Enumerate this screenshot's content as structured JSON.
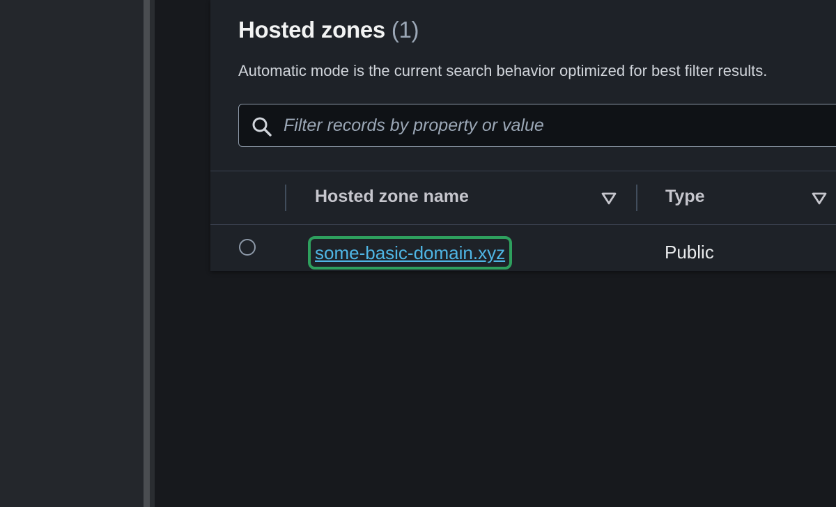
{
  "hosted_zones": {
    "title": "Hosted zones",
    "count": "(1)",
    "description": "Automatic mode is the current search behavior optimized for best filter results.",
    "search": {
      "placeholder": "Filter records by property or value",
      "icon": "search-icon"
    },
    "table": {
      "columns": [
        {
          "label": "Hosted zone name",
          "sort_icon": "caret-down-icon"
        },
        {
          "label": "Type",
          "sort_icon": "caret-down-icon"
        }
      ],
      "rows": [
        {
          "name": "some-basic-domain.xyz",
          "type": "Public",
          "selected": false
        }
      ]
    }
  },
  "colors": {
    "link": "#4fb6e5",
    "highlight": "#2ea05e",
    "panel": "#1e2228",
    "background": "#17191d"
  }
}
